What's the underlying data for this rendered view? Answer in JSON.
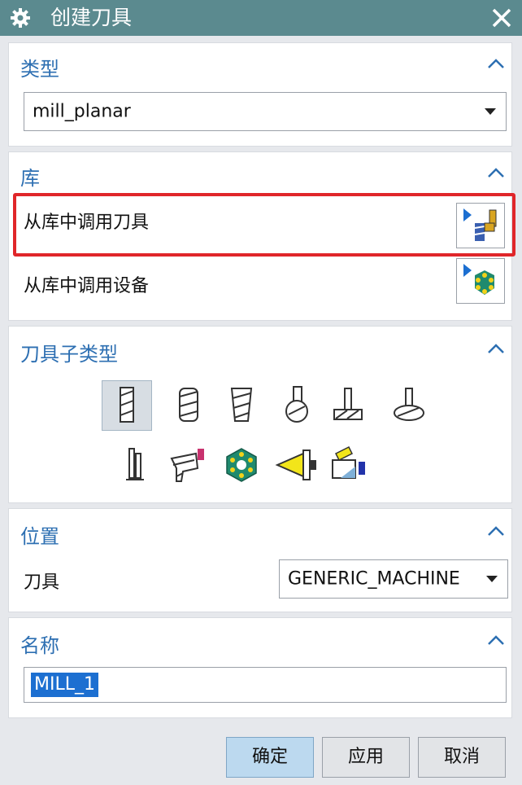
{
  "window": {
    "title": "创建刀具"
  },
  "sections": {
    "type": {
      "title": "类型",
      "value": "mill_planar"
    },
    "library": {
      "title": "库",
      "retrieve_tool_label": "从库中调用刀具",
      "retrieve_device_label": "从库中调用设备"
    },
    "tool_subtype": {
      "title": "刀具子类型",
      "icons": [
        "mill-tool-icon",
        "drill-tool-icon",
        "chamfer-mill-icon",
        "ball-mill-icon",
        "t-cutter-icon",
        "barrel-tool-icon",
        "saw-blade-icon",
        "holder-icon",
        "carrier-icon",
        "probe-icon",
        "assembly-tool-icon"
      ]
    },
    "location": {
      "title": "位置",
      "tool_label": "刀具",
      "tool_value": "GENERIC_MACHINE"
    },
    "name": {
      "title": "名称",
      "value": "MILL_1"
    }
  },
  "buttons": {
    "ok": "确定",
    "apply": "应用",
    "cancel": "取消"
  },
  "colors": {
    "title_bar": "#5b8a8f",
    "section_title": "#2d6fb2",
    "highlight": "#e0262a",
    "selection": "#1c6fd1"
  }
}
